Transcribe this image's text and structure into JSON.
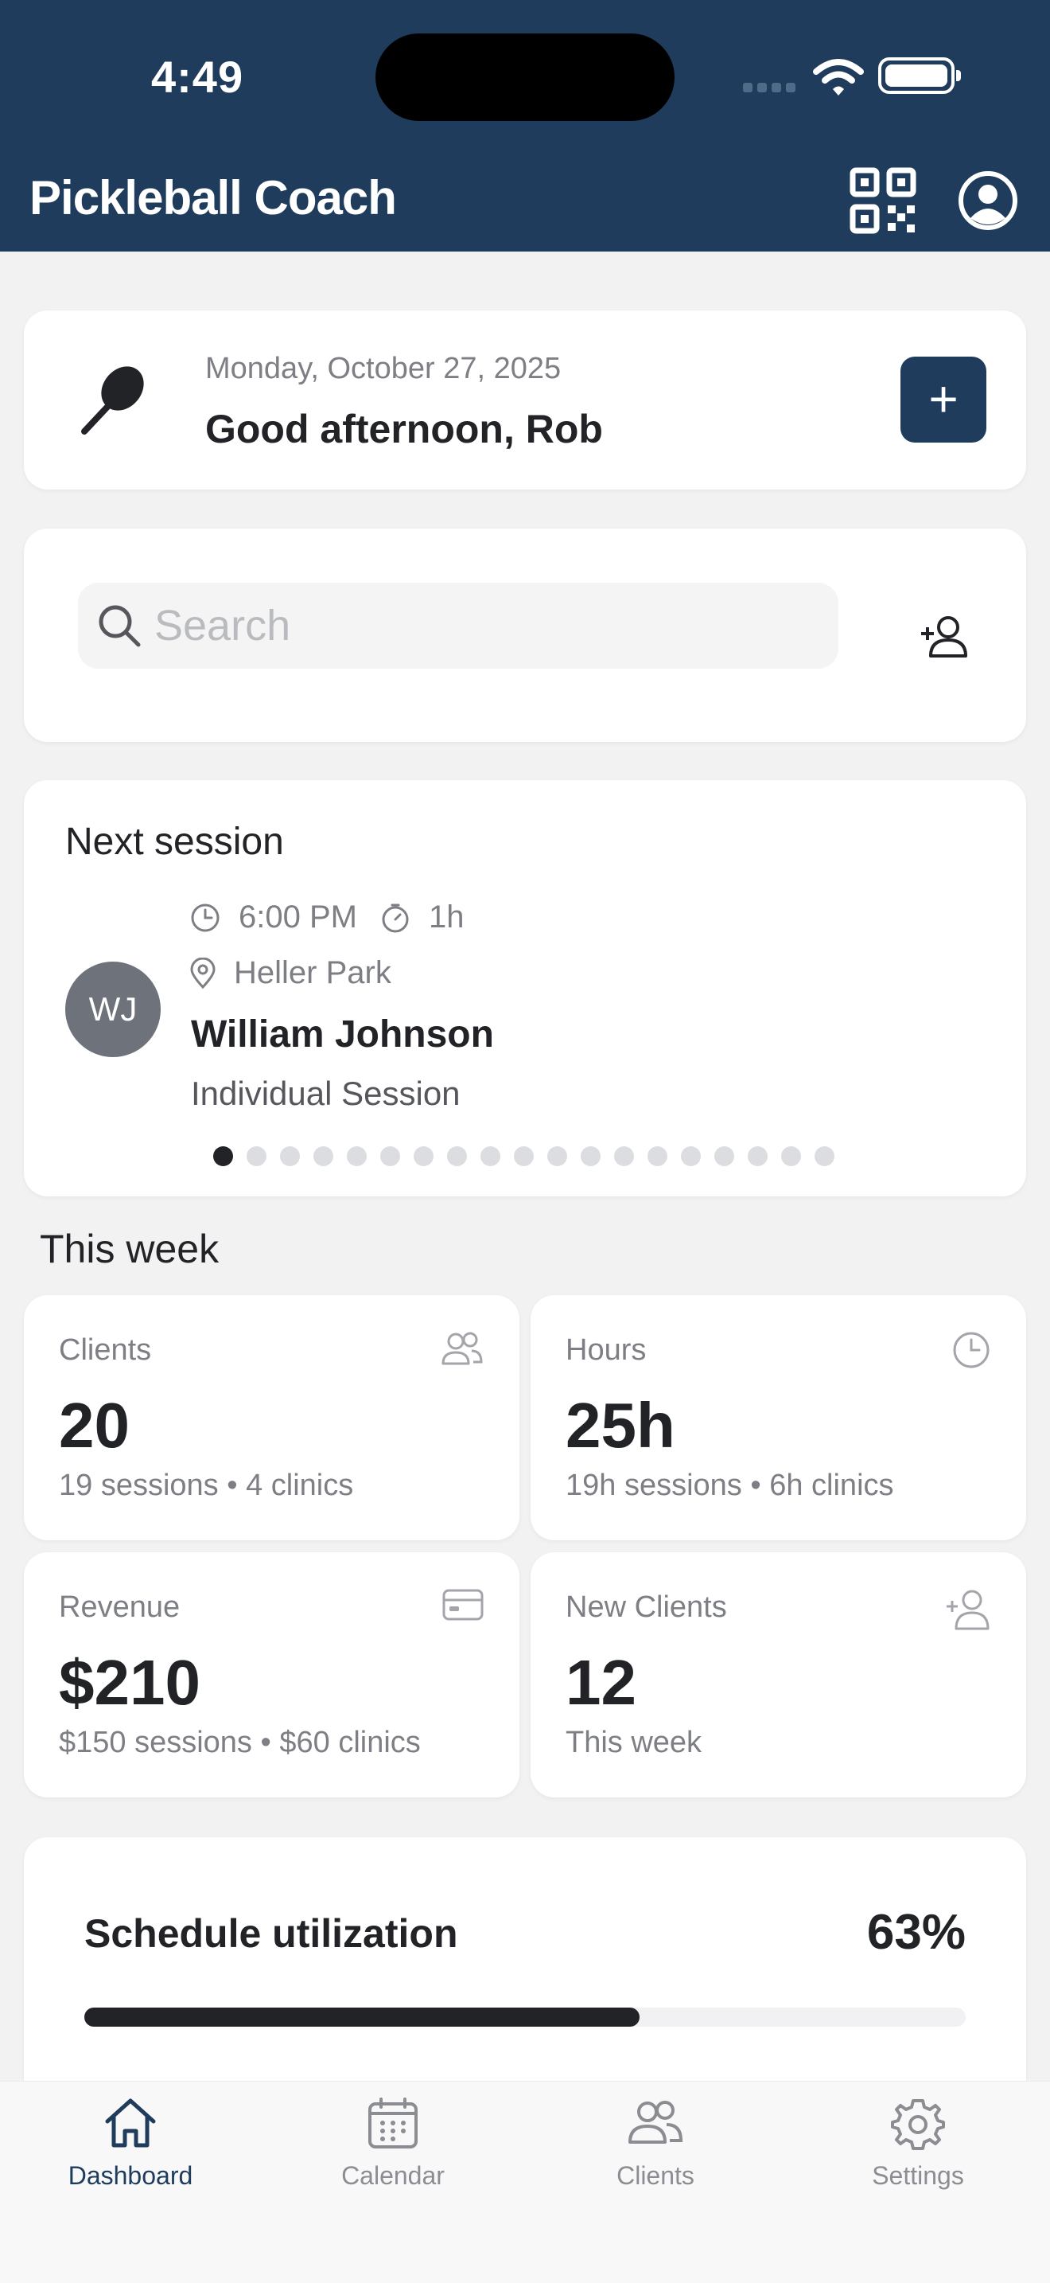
{
  "status_bar": {
    "time": "4:49"
  },
  "header": {
    "title": "Pickleball Coach",
    "qr_icon": "qr-code-icon",
    "profile_icon": "user-circle-icon",
    "color": "#1f3c5c"
  },
  "greeting": {
    "date": "Monday, October 27, 2025",
    "text": "Good afternoon, Rob",
    "add_label": "+"
  },
  "search": {
    "placeholder": "Search",
    "value": ""
  },
  "next_session": {
    "heading": "Next session",
    "time": "6:00 PM",
    "duration": "1h",
    "location": "Heller Park",
    "initials": "WJ",
    "client_name": "William Johnson",
    "session_type": "Individual Session",
    "page_count": 19,
    "current_page": 1
  },
  "week": {
    "title": "This week",
    "stats": [
      {
        "label": "Clients",
        "value": "20",
        "sub": "19 sessions • 4 clinics",
        "icon": "users-icon"
      },
      {
        "label": "Hours",
        "value": "25h",
        "sub": "19h sessions • 6h clinics",
        "icon": "clock-icon"
      },
      {
        "label": "Revenue",
        "value": "$210",
        "sub": "$150 sessions • $60 clinics",
        "icon": "credit-card-icon"
      },
      {
        "label": "New Clients",
        "value": "12",
        "sub": "This week",
        "icon": "user-plus-icon"
      }
    ]
  },
  "utilization": {
    "label": "Schedule utilization",
    "percent_text": "63%",
    "fraction": 0.63
  },
  "tabs": [
    {
      "label": "Dashboard",
      "icon": "home-icon",
      "active": true
    },
    {
      "label": "Calendar",
      "icon": "calendar-icon",
      "active": false
    },
    {
      "label": "Clients",
      "icon": "users-icon",
      "active": false
    },
    {
      "label": "Settings",
      "icon": "gear-icon",
      "active": false
    }
  ]
}
